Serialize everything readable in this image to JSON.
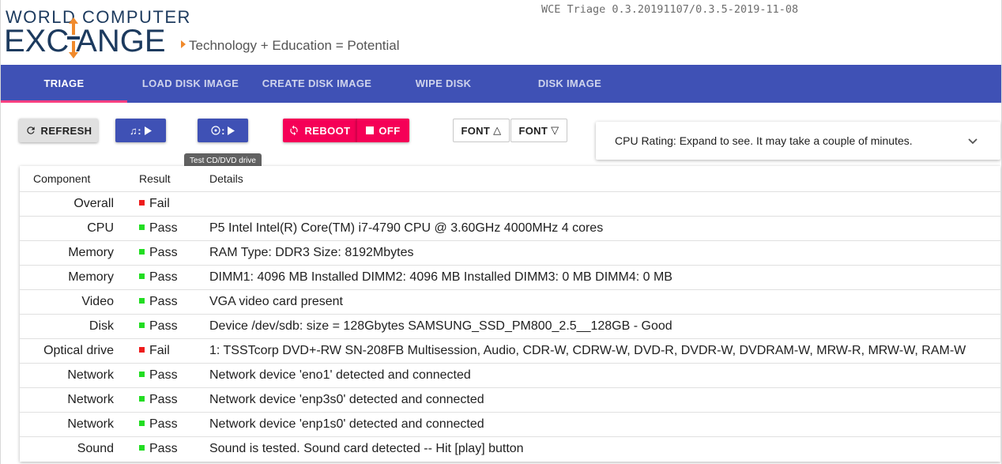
{
  "header": {
    "logo_line1": "WORLD  COMPUTER",
    "logo_line2": "EXC  ANGE",
    "tagline": "Technology + Education = Potential",
    "version": "WCE Triage 0.3.20191107/0.3.5-2019-11-08",
    "brand_color": "#1c3a5e",
    "accent_color": "#f08a2c"
  },
  "tabs": [
    {
      "label": "TRIAGE",
      "active": true
    },
    {
      "label": "LOAD DISK IMAGE",
      "active": false
    },
    {
      "label": "CREATE DISK IMAGE",
      "active": false
    },
    {
      "label": "WIPE DISK",
      "active": false
    },
    {
      "label": "DISK IMAGE",
      "active": false
    }
  ],
  "toolbar": {
    "refresh_label": "REFRESH",
    "refresh_icon": "refresh-icon",
    "sound_icon": "music-note-icon",
    "optical_icon": "disc-icon",
    "play_icon": "play-icon",
    "reboot_label": "REBOOT",
    "reboot_icon": "reboot-icon",
    "off_label": "OFF",
    "off_icon": "stop-icon",
    "font_up_label": "FONT",
    "font_down_label": "FONT",
    "tooltip": "Test CD/DVD drive",
    "primary_color": "#3f51b5",
    "danger_color": "#f50057"
  },
  "cpu_panel": {
    "text": "CPU Rating: Expand to see. It may take a couple of minutes."
  },
  "table": {
    "headers": {
      "component": "Component",
      "result": "Result",
      "details": "Details"
    },
    "rows": [
      {
        "component": "Overall",
        "result": "Fail",
        "status": "fail",
        "details": ""
      },
      {
        "component": "CPU",
        "result": "Pass",
        "status": "pass",
        "details": "P5 Intel Intel(R) Core(TM) i7-4790 CPU @ 3.60GHz 4000MHz 4 cores"
      },
      {
        "component": "Memory",
        "result": "Pass",
        "status": "pass",
        "details": "RAM Type: DDR3 Size: 8192Mbytes"
      },
      {
        "component": "Memory",
        "result": "Pass",
        "status": "pass",
        "details": "DIMM1: 4096 MB Installed DIMM2: 4096 MB Installed DIMM3: 0 MB DIMM4: 0 MB"
      },
      {
        "component": "Video",
        "result": "Pass",
        "status": "pass",
        "details": "VGA video card present"
      },
      {
        "component": "Disk",
        "result": "Pass",
        "status": "pass",
        "details": "Device /dev/sdb: size = 128Gbytes SAMSUNG_SSD_PM800_2.5__128GB - Good"
      },
      {
        "component": "Optical drive",
        "result": "Fail",
        "status": "fail",
        "details": "1: TSSTcorp DVD+-RW SN-208FB Multisession, Audio, CDR-W, CDRW-W, DVD-R, DVDR-W, DVDRAM-W, MRW-R, MRW-W, RAM-W"
      },
      {
        "component": "Network",
        "result": "Pass",
        "status": "pass",
        "details": "Network device 'eno1' detected and connected"
      },
      {
        "component": "Network",
        "result": "Pass",
        "status": "pass",
        "details": "Network device 'enp3s0' detected and connected"
      },
      {
        "component": "Network",
        "result": "Pass",
        "status": "pass",
        "details": "Network device 'enp1s0' detected and connected"
      },
      {
        "component": "Sound",
        "result": "Pass",
        "status": "pass",
        "details": "Sound is tested. Sound card detected -- Hit [play] button"
      }
    ],
    "status_colors": {
      "pass": "#22dd22",
      "fail": "#ee1c1c"
    }
  }
}
